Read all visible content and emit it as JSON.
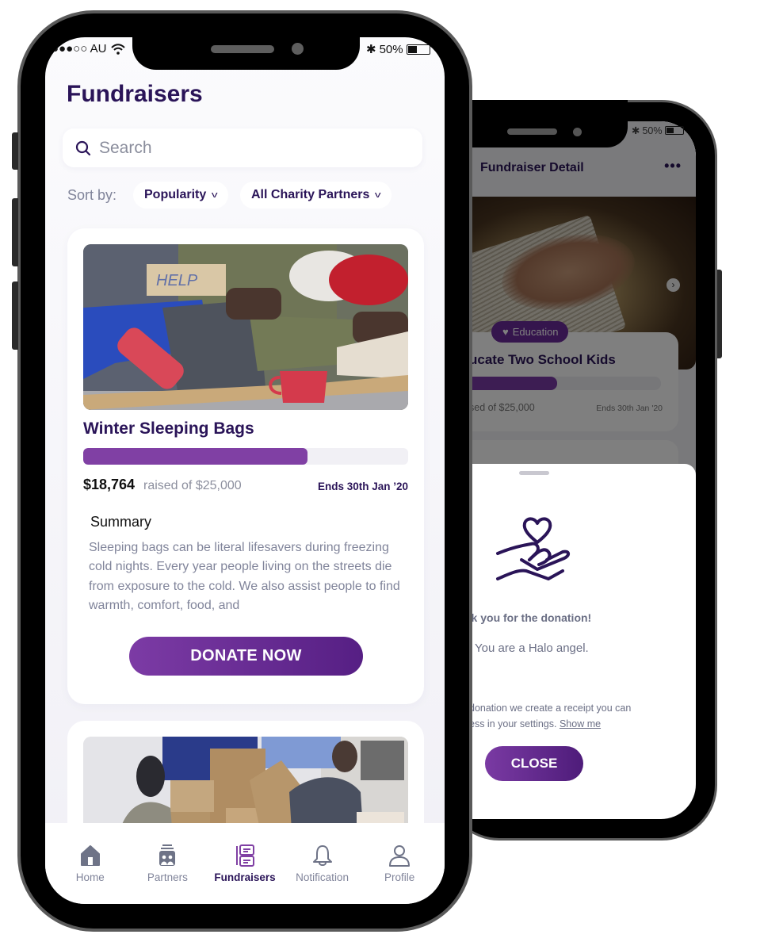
{
  "colors": {
    "brand_dark": "#2a1458",
    "brand_purple": "#7c3ba5",
    "progress_fill": "#8040a4",
    "muted_text": "#80849a"
  },
  "status_bar": {
    "carrier": "●●●○○ AU",
    "battery": "50%",
    "battery_level": 0.5,
    "icons": [
      "wifi-icon",
      "bluetooth-icon",
      "battery-icon"
    ]
  },
  "main_screen": {
    "title": "Fundraisers",
    "search": {
      "placeholder": "Search",
      "value": ""
    },
    "sort_label": "Sort by:",
    "filters": [
      {
        "label": "Popularity",
        "icon": "chevron-down-icon"
      },
      {
        "label": "All Charity Partners",
        "icon": "chevron-down-icon"
      }
    ],
    "fundraisers": [
      {
        "image": "homeless-person-sleeping-bag-photo",
        "title": "Winter Sleeping Bags",
        "raised": "$18,764",
        "raised_of": "raised of $25,000",
        "progress": 0.69,
        "ends": "Ends 30th Jan ’20",
        "summary_title": "Summary",
        "summary": "Sleeping bags can be literal lifesavers during freezing cold nights. Every year people living on the streets die from exposure to the cold. We also assist people to find warmth, comfort, food, and",
        "cta": "DONATE NOW"
      },
      {
        "image": "volunteers-moving-boxes-photo"
      }
    ],
    "tabbar": [
      {
        "label": "Home",
        "icon": "home-icon",
        "active": false
      },
      {
        "label": "Partners",
        "icon": "partners-icon",
        "active": false
      },
      {
        "label": "Fundraisers",
        "icon": "fundraisers-icon",
        "active": true
      },
      {
        "label": "Notification",
        "icon": "bell-icon",
        "active": false
      },
      {
        "label": "Profile",
        "icon": "profile-icon",
        "active": false
      }
    ]
  },
  "detail_screen": {
    "battery": "50%",
    "title": "Fundraiser Detail",
    "more_icon": "•••",
    "category": "Education",
    "fundraiser_title": "ucate Two School Kids",
    "progress": 0.52,
    "raised_of": "sed of $25,000",
    "ends": "Ends 30th Jan '20",
    "sheet": {
      "title": "nk you for the donation!",
      "subtitle": "You are a Halo angel.",
      "note_line1": "donation we create a receipt you can",
      "note_line2": "ess in your settings.",
      "note_link": "Show me",
      "close_label": "CLOSE"
    }
  }
}
